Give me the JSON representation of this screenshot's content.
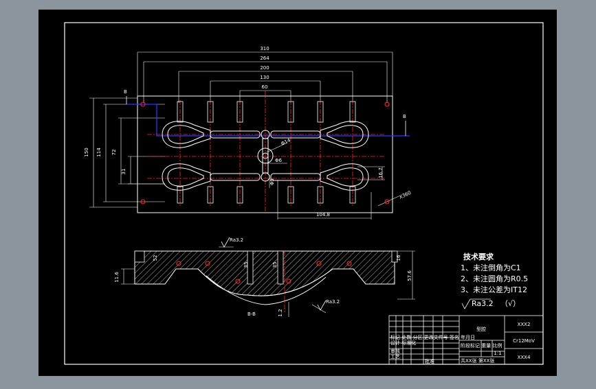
{
  "drawing": {
    "dimensions": {
      "w310": "310",
      "w264": "264",
      "w200": "200",
      "w130": "130",
      "w60": "60",
      "h150": "150",
      "h114": "114",
      "h72": "72",
      "h31": "31",
      "d14": "Φ14",
      "d6": "Φ6",
      "d5": "Φ5",
      "d167": "16.7",
      "d1048": "104.8",
      "x360": "X360",
      "s11_6": "11.6",
      "s52": "52",
      "s35a": "35",
      "s35b": "35",
      "s16": "16",
      "s57_6": "57.6",
      "s1_2": "1.2"
    },
    "labels": {
      "section_b_left": "B",
      "section_b_right": "B",
      "section_view": "B-B",
      "roughness_left": "Ra3.2",
      "roughness_right": "Ra3.2"
    }
  },
  "notes": {
    "title": "技术要求",
    "items": [
      "1、未注倒角为C1",
      "2、未注圆角为R0.5",
      "3、未注公差为IT12"
    ],
    "roughness": "Ra3.2",
    "roughness_extra": "（√）"
  },
  "title_block": {
    "part_name": "型腔",
    "drawing_no": "XXX2",
    "material": "Cr12MoV",
    "company": "XXX4",
    "col_headers": "标记 处数 分区 更改文件号 签名 年月日",
    "designer_row": "设计 标准化",
    "checker": "审核",
    "process": "工艺",
    "approve": "批准",
    "stage_headers": "阶段标记 重量 比例",
    "scale": "1:1",
    "sheet": "共XX张 第XX张"
  },
  "colors": {
    "paper": "#000000",
    "outer": "#8c949e",
    "line": "#ffffff",
    "center": "#ff2a2a",
    "hidden": "#2b3bff"
  }
}
